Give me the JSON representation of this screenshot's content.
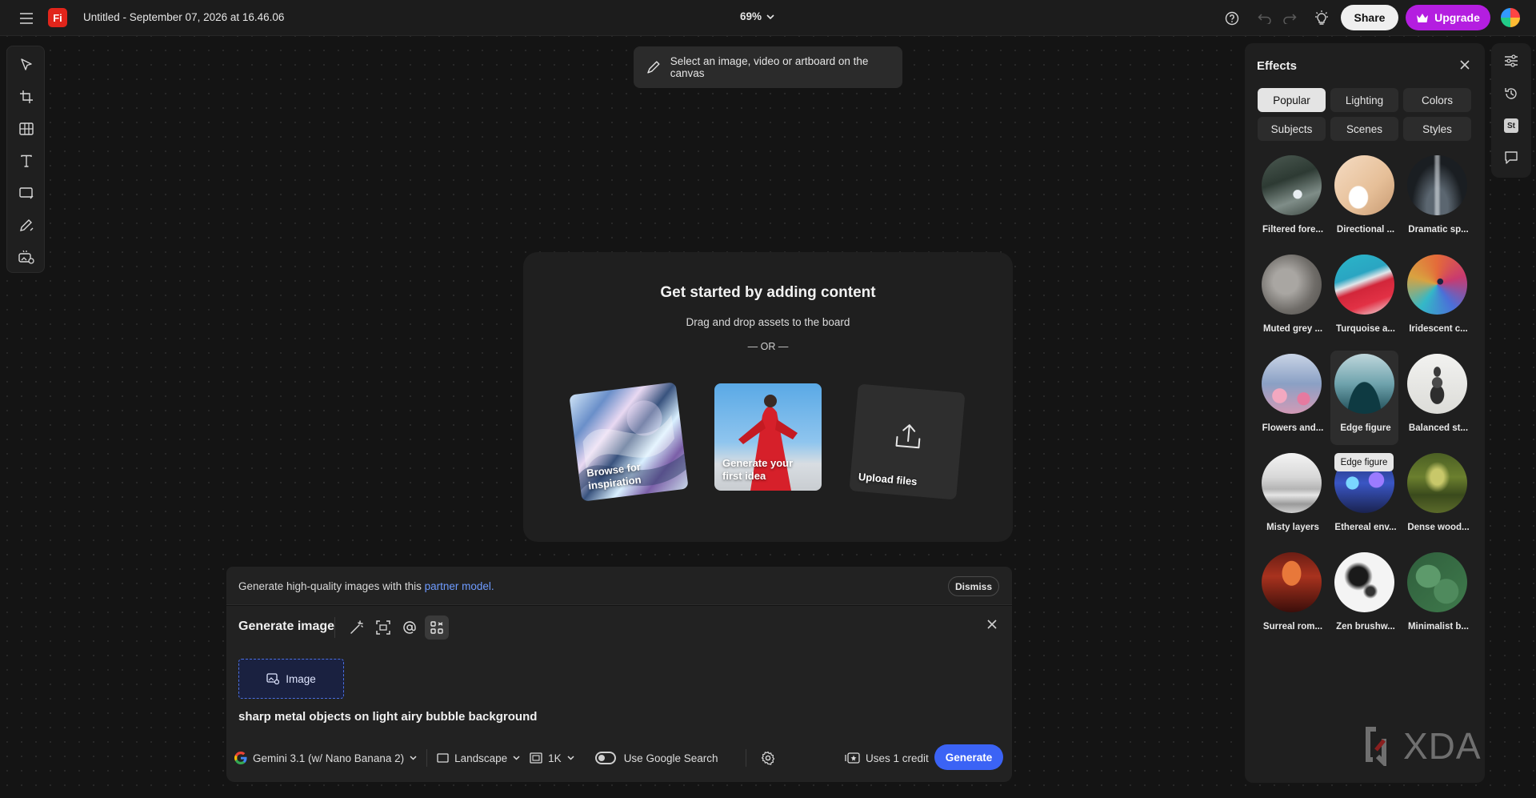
{
  "topbar": {
    "app_logo": "Fi",
    "doc_title": "Untitled - September 07, 2026 at 16.46.06",
    "zoom": "69%",
    "share_label": "Share",
    "upgrade_label": "Upgrade",
    "upgrade_color": "#b41ee0"
  },
  "left_toolbar": {
    "tools": [
      "select-tool",
      "frame-tool",
      "grid-tool",
      "text-tool",
      "shape-tool",
      "pen-tool",
      "generate-tool"
    ]
  },
  "canvas_hint": "Select an image, video or artboard on the canvas",
  "get_started": {
    "title": "Get started by adding content",
    "subtitle": "Drag and drop assets to the board",
    "or": "— OR —",
    "browse": "Browse for inspiration",
    "generate": "Generate your first idea",
    "upload": "Upload files"
  },
  "partner": {
    "text": "Generate high-quality images with this",
    "link": "partner model.",
    "dismiss": "Dismiss"
  },
  "generate": {
    "title": "Generate image",
    "reference_label": "Image",
    "prompt": "sharp metal objects on light airy bubble background",
    "model": "Gemini 3.1 (w/ Nano Banana 2)",
    "orientation": "Landscape",
    "resolution": "1K",
    "google_search": "Use Google Search",
    "credit": "Uses 1 credit",
    "button": "Generate",
    "accent": "#3b63f5"
  },
  "effects": {
    "title": "Effects",
    "tabs": [
      "Popular",
      "Lighting",
      "Colors",
      "Subjects",
      "Scenes",
      "Styles"
    ],
    "items": [
      {
        "label": "Filtered fore..."
      },
      {
        "label": "Directional ..."
      },
      {
        "label": "Dramatic sp..."
      },
      {
        "label": "Muted grey ..."
      },
      {
        "label": "Turquoise a..."
      },
      {
        "label": "Iridescent c..."
      },
      {
        "label": "Flowers and..."
      },
      {
        "label": "Edge figure"
      },
      {
        "label": "Balanced st..."
      },
      {
        "label": "Misty layers"
      },
      {
        "label": "Ethereal env..."
      },
      {
        "label": "Dense wood..."
      },
      {
        "label": "Surreal rom..."
      },
      {
        "label": "Zen brushw..."
      },
      {
        "label": "Minimalist b..."
      }
    ],
    "tooltip": "Edge figure"
  },
  "right_rail": {
    "stock_label": "St"
  },
  "watermark": "XDA"
}
